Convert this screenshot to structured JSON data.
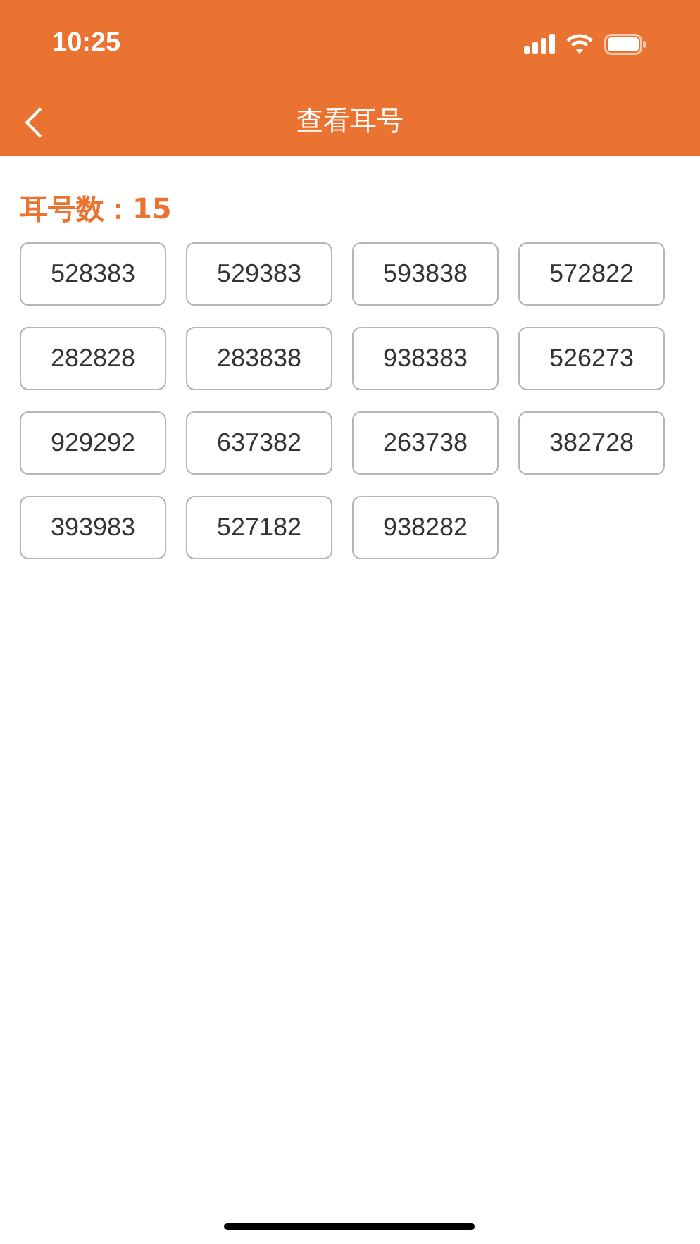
{
  "status_bar": {
    "time": "10:25"
  },
  "nav_bar": {
    "title": "查看耳号"
  },
  "ear_tag_count": {
    "label": "耳号数：",
    "value": "15"
  },
  "ear_tags": [
    "528383",
    "529383",
    "593838",
    "572822",
    "282828",
    "283838",
    "938383",
    "526273",
    "929292",
    "637382",
    "263738",
    "382728",
    "393983",
    "527182",
    "938282"
  ]
}
